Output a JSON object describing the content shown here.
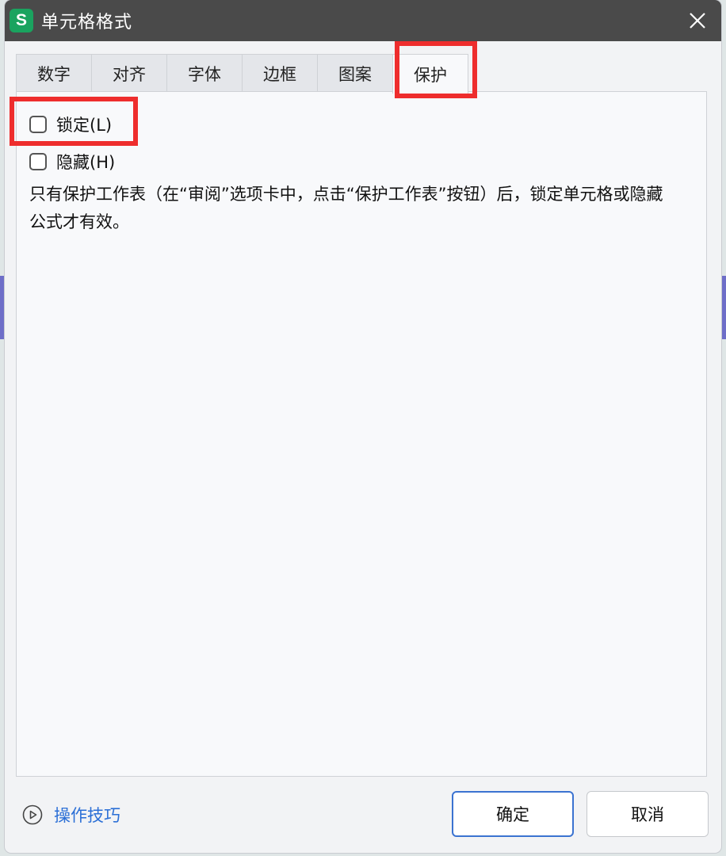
{
  "window": {
    "title": "单元格格式",
    "app_icon_letter": "S",
    "app_icon_color": "#1aa35f",
    "close_icon": "close-icon"
  },
  "tabs": [
    {
      "label": "数字",
      "active": false
    },
    {
      "label": "对齐",
      "active": false
    },
    {
      "label": "字体",
      "active": false
    },
    {
      "label": "边框",
      "active": false
    },
    {
      "label": "图案",
      "active": false
    },
    {
      "label": "保护",
      "active": true
    }
  ],
  "protection": {
    "lock": {
      "label": "锁定(L)",
      "checked": false
    },
    "hide": {
      "label": "隐藏(H)",
      "checked": false
    },
    "description": "只有保护工作表（在“审阅”选项卡中，点击“保护工作表”按钮）后，锁定单元格或隐藏公式才有效。"
  },
  "footer": {
    "tips_label": "操作技巧",
    "tips_icon": "play-circle-icon",
    "ok_label": "确定",
    "cancel_label": "取消"
  },
  "colors": {
    "accent": "#2b6fd6",
    "highlight": "#ee2d2d",
    "titlebar": "#4a4a4a"
  }
}
